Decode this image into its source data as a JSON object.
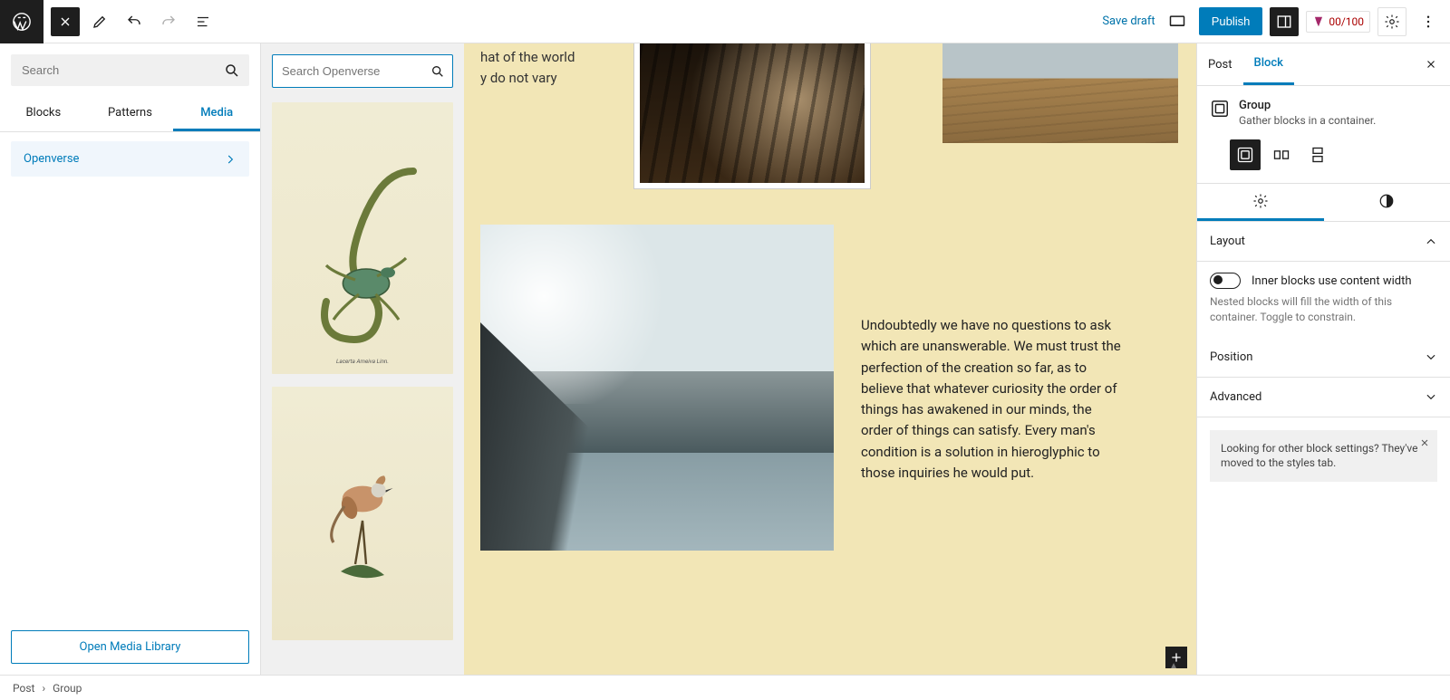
{
  "toolbar": {
    "save_draft": "Save draft",
    "publish": "Publish",
    "yoast_score": "00/100"
  },
  "inserter": {
    "search_placeholder": "Search",
    "tabs": {
      "blocks": "Blocks",
      "patterns": "Patterns",
      "media": "Media"
    },
    "media_category": "Openverse",
    "open_library": "Open Media Library"
  },
  "openverse": {
    "search_placeholder": "Search Openverse"
  },
  "canvas": {
    "top_text_line1": "hat of the world",
    "top_text_line2": "y do not vary",
    "paragraph": "Undoubtedly we have no questions to ask which are unanswerable. We must trust the perfection of the creation so far, as to believe that whatever curiosity the order of things has awakened in our minds, the order of things can satisfy. Every man's condition is a solution in hieroglyphic to those inquiries he would put."
  },
  "sidebar": {
    "tabs": {
      "post": "Post",
      "block": "Block"
    },
    "block_title": "Group",
    "block_desc": "Gather blocks in a container.",
    "layout_label": "Layout",
    "toggle_label": "Inner blocks use content width",
    "toggle_hint": "Nested blocks will fill the width of this container. Toggle to constrain.",
    "position_label": "Position",
    "advanced_label": "Advanced",
    "notice": "Looking for other block settings? They've moved to the styles tab."
  },
  "breadcrumb": {
    "post": "Post",
    "group": "Group"
  }
}
